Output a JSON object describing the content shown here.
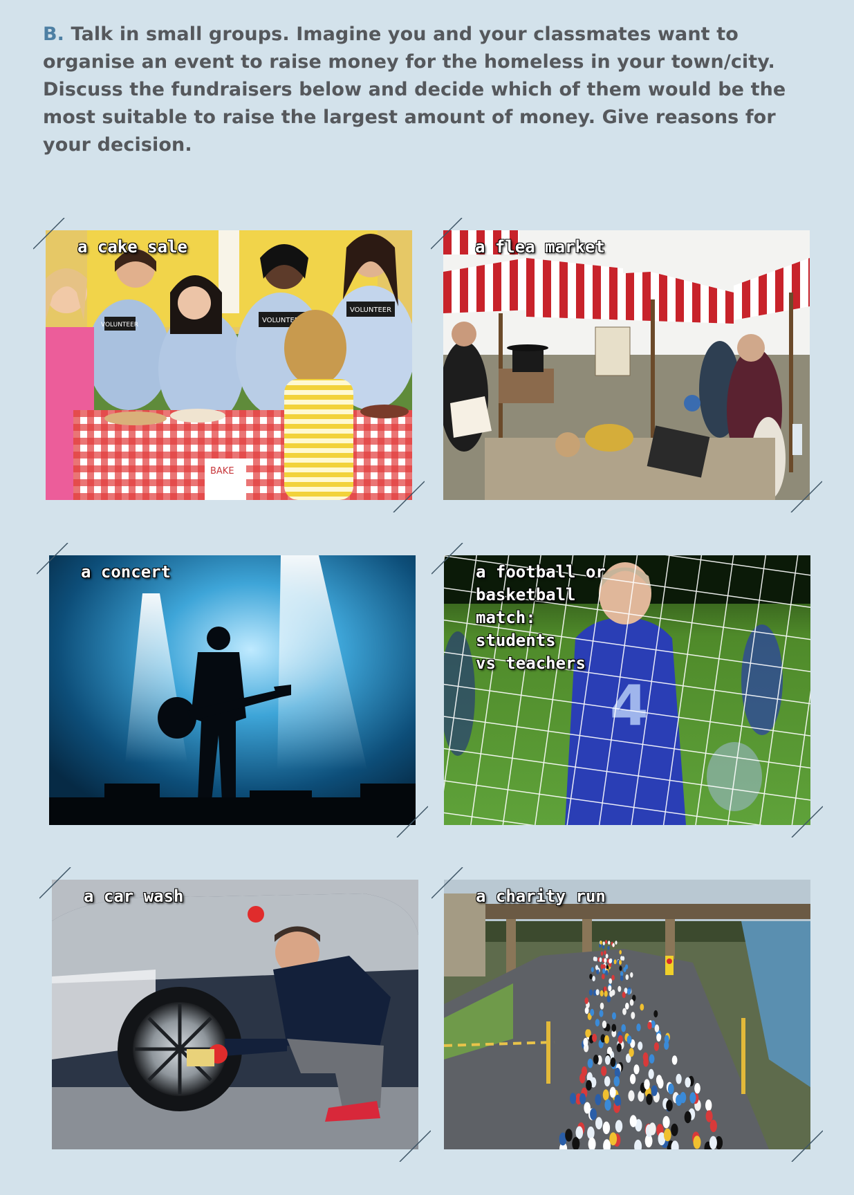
{
  "instruction": {
    "letter": "B.",
    "text": "Talk in small groups. Imagine you and your classmates want to organise an event to raise money for the homeless in your town/city. Discuss the fundraisers below and decide which of them would be the most suitable to raise the largest amount of money. Give reasons for your decision."
  },
  "cards": [
    {
      "caption": "a cake sale"
    },
    {
      "caption": "a flea market"
    },
    {
      "caption": "a concert"
    },
    {
      "caption_lines": [
        "a football or",
        "basketball",
        "match:",
        "students",
        "vs teachers"
      ]
    },
    {
      "caption": "a car wash"
    },
    {
      "caption": "a charity run"
    }
  ],
  "photo_text": {
    "volunteer": "VOLUNTEER",
    "bake_sign": "BAKE",
    "jersey_number": "4"
  }
}
